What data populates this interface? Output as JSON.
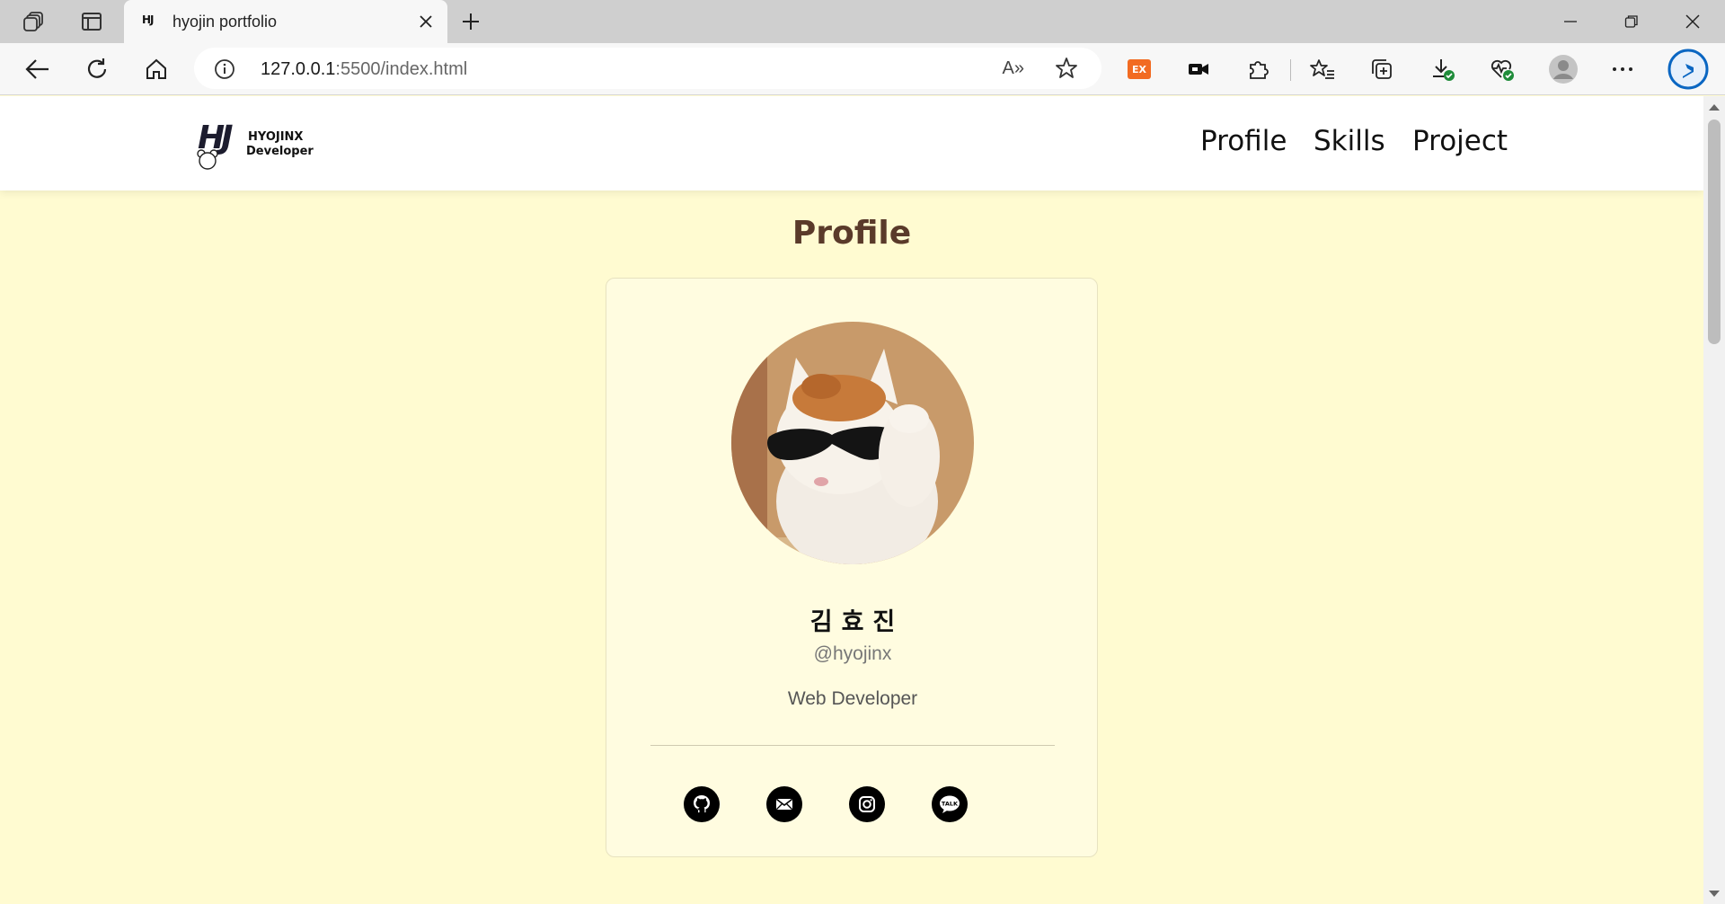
{
  "browser": {
    "tab_title": "hyojin portfolio",
    "tab_favicon_text": "HJ",
    "url_host": "127.0.0.1",
    "url_rest": ":5500/index.html",
    "read_aloud_label": "A»",
    "extension_badge": "EX",
    "icons": {
      "workspaces": "workspaces-icon",
      "tab_actions": "tab-actions-icon",
      "close_tab": "close-icon",
      "new_tab": "plus-icon",
      "minimize": "minimize-icon",
      "restore": "restore-icon",
      "close_window": "close-icon",
      "back": "back-arrow-icon",
      "refresh": "refresh-icon",
      "home": "home-icon",
      "site_info": "info-icon",
      "favorite": "star-icon"
    },
    "accent": "#0a66c2"
  },
  "site": {
    "logo_mark": "HJ",
    "logo_line1": "HYOJINX",
    "logo_line2": "Developer",
    "nav": [
      "Profile",
      "Skills",
      "Project"
    ]
  },
  "profile": {
    "section_title": "Profile",
    "name": "김효진",
    "handle": "@hyojinx",
    "role": "Web Developer",
    "social": [
      "github-icon",
      "mail-icon",
      "instagram-icon",
      "kakaotalk-icon"
    ],
    "kakao_text": "TALK"
  },
  "colors": {
    "page_bg": "#fffbd1",
    "card_bg": "#fffce0",
    "title": "#5a3a2a"
  }
}
